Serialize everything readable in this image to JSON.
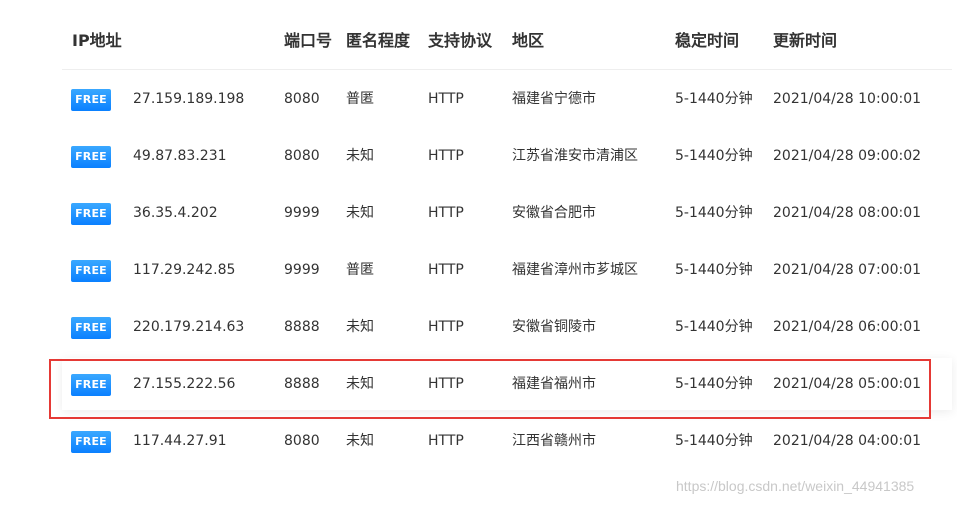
{
  "headers": {
    "ip": "IP地址",
    "port": "端口号",
    "anonymity": "匿名程度",
    "protocol": "支持协议",
    "region": "地区",
    "stable": "稳定时间",
    "updated": "更新时间"
  },
  "badge_label": "FREE",
  "rows": [
    {
      "ip": "27.159.189.198",
      "port": "8080",
      "anonymity": "普匿",
      "protocol": "HTTP",
      "region": "福建省宁德市",
      "stable": "5-1440分钟",
      "updated": "2021/04/28 10:00:01"
    },
    {
      "ip": "49.87.83.231",
      "port": "8080",
      "anonymity": "未知",
      "protocol": "HTTP",
      "region": "江苏省淮安市清浦区",
      "stable": "5-1440分钟",
      "updated": "2021/04/28 09:00:02"
    },
    {
      "ip": "36.35.4.202",
      "port": "9999",
      "anonymity": "未知",
      "protocol": "HTTP",
      "region": "安徽省合肥市",
      "stable": "5-1440分钟",
      "updated": "2021/04/28 08:00:01"
    },
    {
      "ip": "117.29.242.85",
      "port": "9999",
      "anonymity": "普匿",
      "protocol": "HTTP",
      "region": "福建省漳州市芗城区",
      "stable": "5-1440分钟",
      "updated": "2021/04/28 07:00:01"
    },
    {
      "ip": "220.179.214.63",
      "port": "8888",
      "anonymity": "未知",
      "protocol": "HTTP",
      "region": "安徽省铜陵市",
      "stable": "5-1440分钟",
      "updated": "2021/04/28 06:00:01"
    },
    {
      "ip": "27.155.222.56",
      "port": "8888",
      "anonymity": "未知",
      "protocol": "HTTP",
      "region": "福建省福州市",
      "stable": "5-1440分钟",
      "updated": "2021/04/28 05:00:01"
    },
    {
      "ip": "117.44.27.91",
      "port": "8080",
      "anonymity": "未知",
      "protocol": "HTTP",
      "region": "江西省赣州市",
      "stable": "5-1440分钟",
      "updated": "2021/04/28 04:00:01"
    }
  ],
  "highlighted_row_index": 5,
  "colors": {
    "badge_top": "#3aa8ff",
    "badge_bottom": "#0a80ff",
    "highlight_border": "#e53935",
    "text": "#333333"
  },
  "watermark": "https://blog.csdn.net/weixin_44941385"
}
